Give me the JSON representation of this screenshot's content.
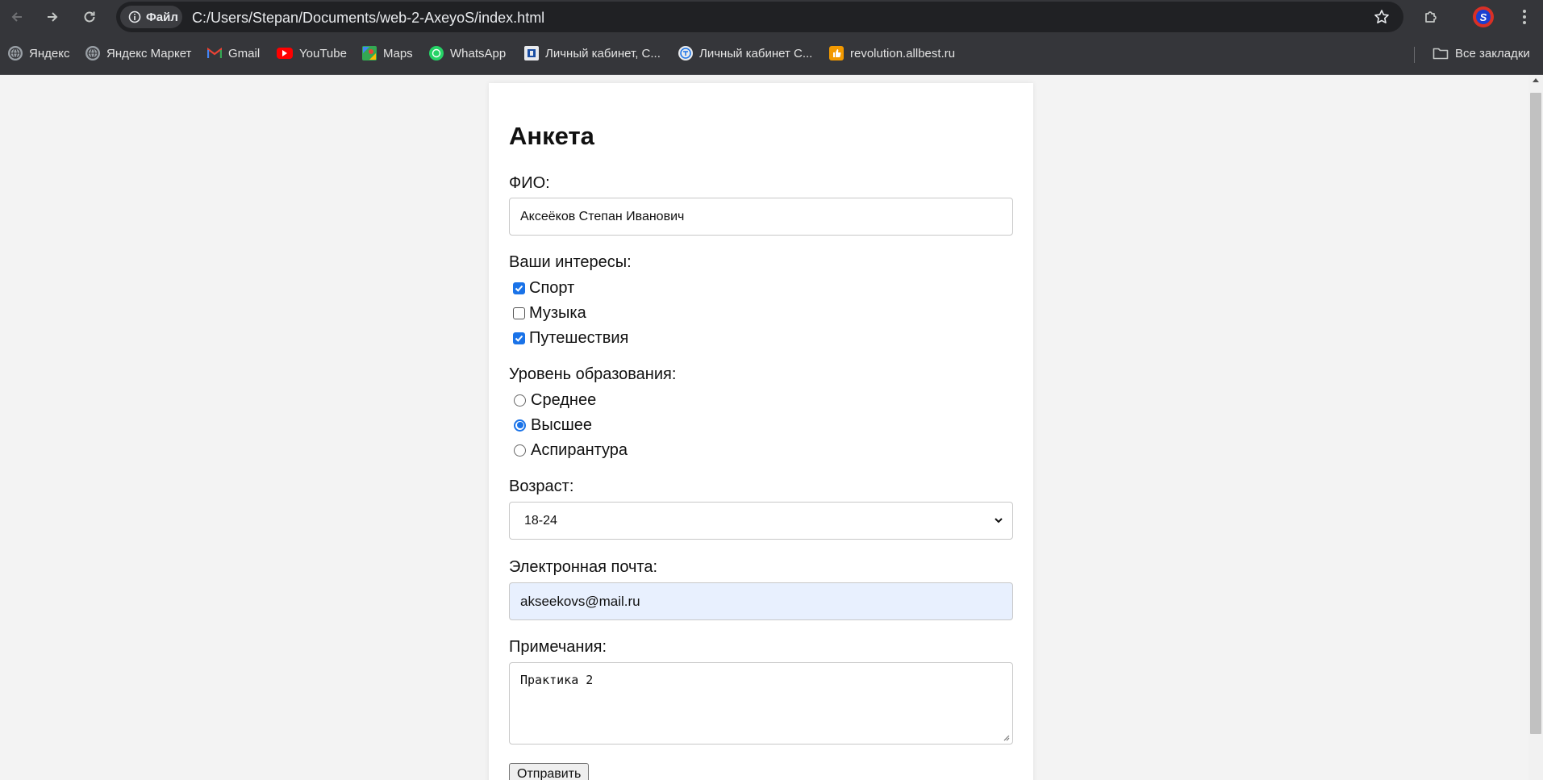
{
  "browser": {
    "address": {
      "chip_label": "Файл",
      "url": "C:/Users/Stepan/Documents/web-2-AxeyoS/index.html"
    },
    "profile_initial": "S",
    "bookmarks": [
      {
        "label": "Яндекс",
        "icon": "globe-icon"
      },
      {
        "label": "Яндекс Маркет",
        "icon": "globe-icon"
      },
      {
        "label": "Gmail",
        "icon": "gmail-icon"
      },
      {
        "label": "YouTube",
        "icon": "youtube-icon"
      },
      {
        "label": "Maps",
        "icon": "maps-icon"
      },
      {
        "label": "WhatsApp",
        "icon": "whatsapp-icon"
      },
      {
        "label": "Личный кабинет, С...",
        "icon": "site-icon"
      },
      {
        "label": "Личный кабинет С...",
        "icon": "site-icon"
      },
      {
        "label": "revolution.allbest.ru",
        "icon": "thumbs-up-icon"
      }
    ],
    "all_bookmarks_label": "Все закладки"
  },
  "form": {
    "title": "Анкета",
    "fio_label": "ФИО:",
    "fio_value": "Аксеёков Степан Иванович",
    "interests_label": "Ваши интересы:",
    "interests": [
      {
        "label": "Спорт",
        "checked": true
      },
      {
        "label": "Музыка",
        "checked": false
      },
      {
        "label": "Путешествия",
        "checked": true
      }
    ],
    "education_label": "Уровень образования:",
    "education": [
      {
        "label": "Среднее",
        "selected": false
      },
      {
        "label": "Высшее",
        "selected": true
      },
      {
        "label": "Аспирантура",
        "selected": false
      }
    ],
    "age_label": "Возраст:",
    "age_value": "18-24",
    "email_label": "Электронная почта:",
    "email_value": "akseekovs@mail.ru",
    "notes_label": "Примечания:",
    "notes_value": "Практика 2",
    "submit_label": "Отправить"
  },
  "colors": {
    "chrome_bg": "#35363a",
    "accent": "#1a73e8",
    "page_bg": "#f3f3f3",
    "autofill_bg": "#e8f0fe"
  }
}
